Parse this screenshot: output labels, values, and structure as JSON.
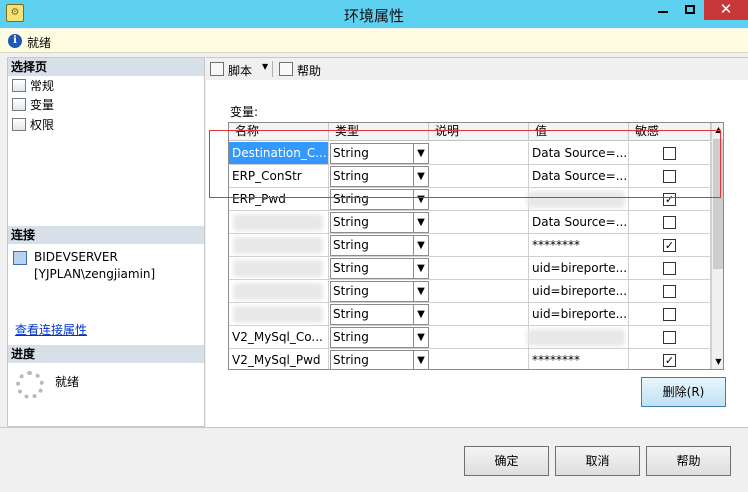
{
  "window": {
    "title": "环境属性"
  },
  "status": {
    "text": "就绪"
  },
  "left": {
    "select_page_header": "选择页",
    "pages": [
      {
        "label": "常规",
        "icon": "wrench-page-icon"
      },
      {
        "label": "变量",
        "icon": "wrench-page-icon"
      },
      {
        "label": "权限",
        "icon": "wrench-page-icon"
      }
    ],
    "connection_header": "连接",
    "server": "BIDEVSERVER",
    "user": "[YJPLAN\\zengjiamin]",
    "view_connection_link": "查看连接属性",
    "progress_header": "进度",
    "progress_text": "就绪"
  },
  "toolbar": {
    "script_label": "脚本",
    "help_label": "帮助"
  },
  "variables": {
    "label": "变量:",
    "columns": [
      "名称",
      "类型",
      "说明",
      "值",
      "敏感"
    ],
    "rows": [
      {
        "name": "Destination_C...",
        "type": "String",
        "desc": "",
        "value": "Data Source=...",
        "sensitive": false
      },
      {
        "name": "ERP_ConStr",
        "type": "String",
        "desc": "",
        "value": "Data Source=...",
        "sensitive": false
      },
      {
        "name": "ERP_Pwd",
        "type": "String",
        "desc": "",
        "value": "",
        "sensitive": true
      },
      {
        "name": "",
        "type": "String",
        "desc": "",
        "value": "Data Source=...",
        "sensitive": false
      },
      {
        "name": "",
        "type": "String",
        "desc": "",
        "value": "********",
        "sensitive": true
      },
      {
        "name": "",
        "type": "String",
        "desc": "",
        "value": "uid=bireporte...",
        "sensitive": false
      },
      {
        "name": "",
        "type": "String",
        "desc": "",
        "value": "uid=bireporte...",
        "sensitive": false
      },
      {
        "name": "",
        "type": "String",
        "desc": "",
        "value": "uid=bireporte...",
        "sensitive": false
      },
      {
        "name": "V2_MySql_Co...",
        "type": "String",
        "desc": "",
        "value": "",
        "sensitive": false
      },
      {
        "name": "V2_MySql_Pwd",
        "type": "String",
        "desc": "",
        "value": "********",
        "sensitive": true
      }
    ]
  },
  "buttons": {
    "delete": "删除(R)",
    "ok": "确定",
    "cancel": "取消",
    "help": "帮助"
  }
}
